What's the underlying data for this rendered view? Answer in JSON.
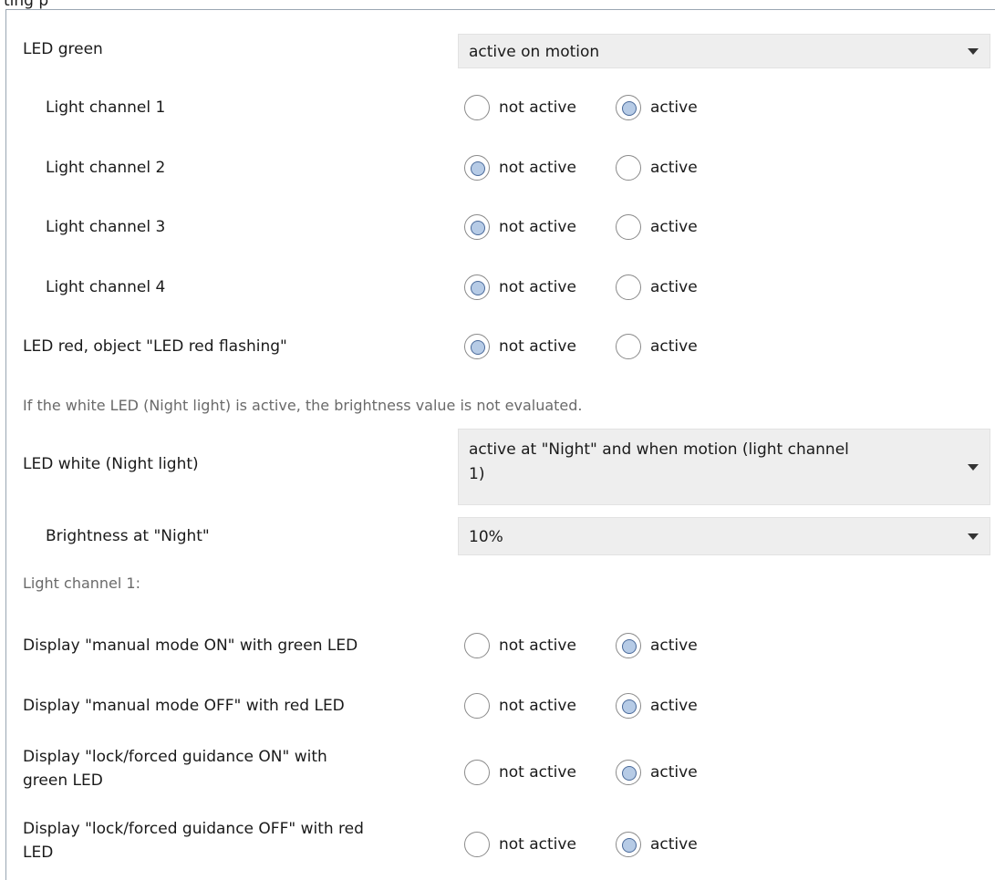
{
  "header_fragment": "ting p",
  "led_green": {
    "label": "LED green",
    "value": "active on motion"
  },
  "channels": [
    {
      "label": "Light channel 1",
      "selected": "active"
    },
    {
      "label": "Light channel 2",
      "selected": "not_active"
    },
    {
      "label": "Light channel 3",
      "selected": "not_active"
    },
    {
      "label": "Light channel 4",
      "selected": "not_active"
    }
  ],
  "led_red": {
    "label": "LED red, object \"LED red flashing\"",
    "selected": "not_active"
  },
  "options": {
    "not_active": "not active",
    "active": "active"
  },
  "white_info": "If the white LED (Night light) is active, the brightness value is not evaluated.",
  "led_white": {
    "label": "LED white (Night light)",
    "value_line1": "active at \"Night\" and when motion (light channel",
    "value_line2": "1)"
  },
  "brightness": {
    "label": "Brightness at \"Night\"",
    "value": "10%"
  },
  "channel1_heading": "Light channel 1:",
  "displays": [
    {
      "label_line1": "Display \"manual mode ON\" with green LED",
      "label_line2": "",
      "selected": "active"
    },
    {
      "label_line1": "Display \"manual mode OFF\" with red LED",
      "label_line2": "",
      "selected": "active"
    },
    {
      "label_line1": "Display \"lock/forced guidance ON\" with",
      "label_line2": "green LED",
      "selected": "active"
    },
    {
      "label_line1": "Display \"lock/forced guidance OFF\" with red",
      "label_line2": "LED",
      "selected": "active"
    }
  ],
  "colors": {
    "panel_border": "#9aa6b2",
    "dropdown_bg": "#eeeeee",
    "radio_dot": "#b6cbe6",
    "radio_dot_border": "#4a6a9a",
    "info_text": "#6a6a6a"
  }
}
